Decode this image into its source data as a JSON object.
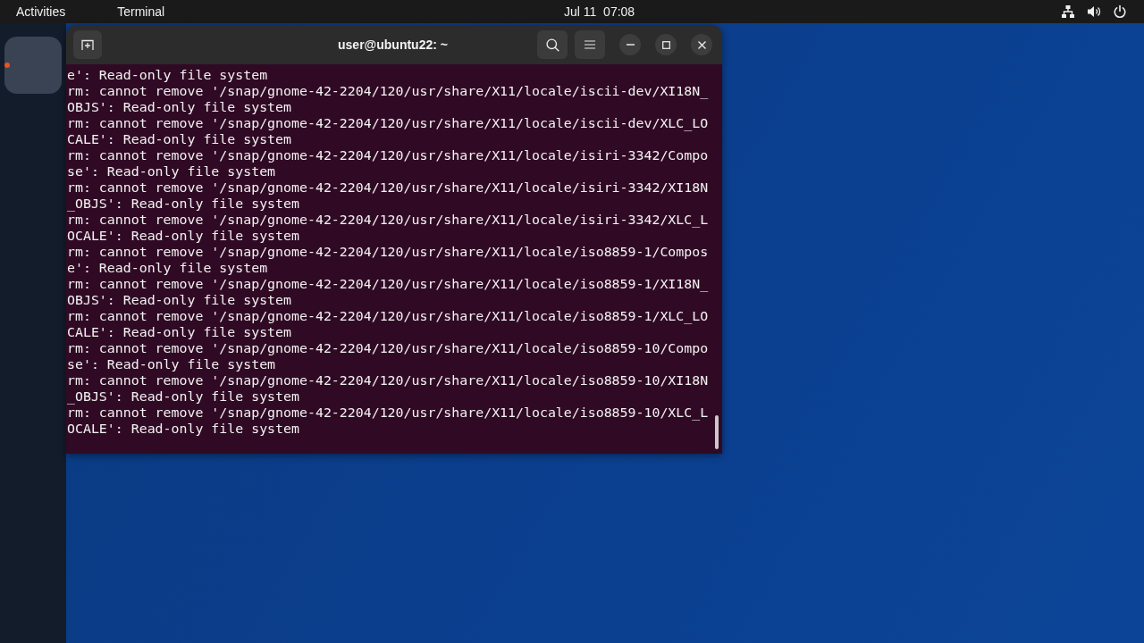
{
  "top_bar": {
    "activities": "Activities",
    "app_menu": "Terminal",
    "clock": "Jul 11  07:08"
  },
  "dock": {
    "apps": [
      {
        "running": true
      }
    ]
  },
  "window": {
    "title": "user@ubuntu22: ~",
    "lines": [
      "e': Read-only file system",
      "rm: cannot remove '/snap/gnome-42-2204/120/usr/share/X11/locale/iscii-dev/XI18N_",
      "OBJS': Read-only file system",
      "rm: cannot remove '/snap/gnome-42-2204/120/usr/share/X11/locale/iscii-dev/XLC_LO",
      "CALE': Read-only file system",
      "rm: cannot remove '/snap/gnome-42-2204/120/usr/share/X11/locale/isiri-3342/Compo",
      "se': Read-only file system",
      "rm: cannot remove '/snap/gnome-42-2204/120/usr/share/X11/locale/isiri-3342/XI18N",
      "_OBJS': Read-only file system",
      "rm: cannot remove '/snap/gnome-42-2204/120/usr/share/X11/locale/isiri-3342/XLC_L",
      "OCALE': Read-only file system",
      "rm: cannot remove '/snap/gnome-42-2204/120/usr/share/X11/locale/iso8859-1/Compos",
      "e': Read-only file system",
      "rm: cannot remove '/snap/gnome-42-2204/120/usr/share/X11/locale/iso8859-1/XI18N_",
      "OBJS': Read-only file system",
      "rm: cannot remove '/snap/gnome-42-2204/120/usr/share/X11/locale/iso8859-1/XLC_LO",
      "CALE': Read-only file system",
      "rm: cannot remove '/snap/gnome-42-2204/120/usr/share/X11/locale/iso8859-10/Compo",
      "se': Read-only file system",
      "rm: cannot remove '/snap/gnome-42-2204/120/usr/share/X11/locale/iso8859-10/XI18N",
      "_OBJS': Read-only file system",
      "rm: cannot remove '/snap/gnome-42-2204/120/usr/share/X11/locale/iso8859-10/XLC_L",
      "OCALE': Read-only file system"
    ]
  }
}
